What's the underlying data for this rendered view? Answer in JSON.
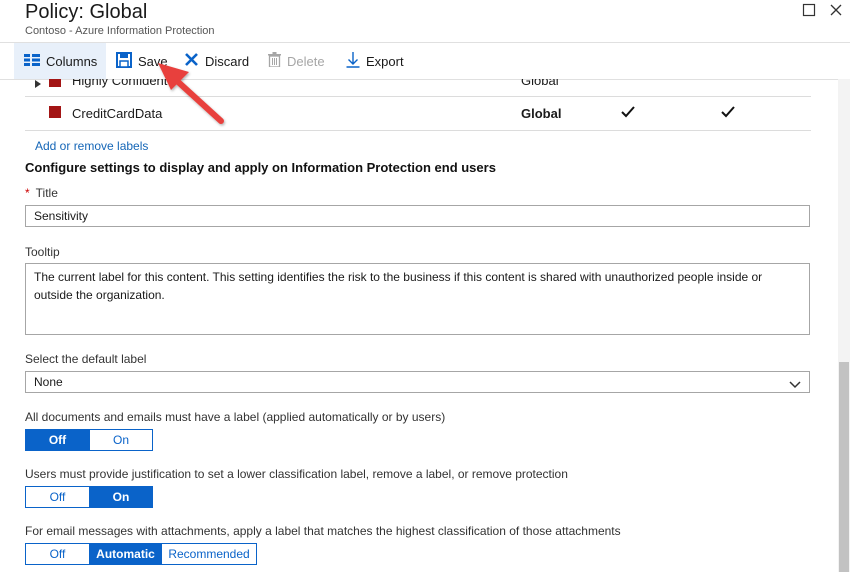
{
  "header": {
    "title": "Policy: Global",
    "subtitle": "Contoso - Azure Information Protection"
  },
  "toolbar": {
    "columns_label": "Columns",
    "save_label": "Save",
    "discard_label": "Discard",
    "delete_label": "Delete",
    "export_label": "Export"
  },
  "labels_table": {
    "rows": [
      {
        "name": "Highly Confident",
        "scope": "Global",
        "color": "#a31515"
      },
      {
        "name": "CreditCardData",
        "scope": "Global",
        "color": "#a31515",
        "check1": true,
        "check2": true
      }
    ],
    "add_remove_link": "Add or remove labels"
  },
  "settings": {
    "section_title": "Configure settings to display and apply on Information Protection end users",
    "title_field": {
      "label": "Title",
      "value": "Sensitivity"
    },
    "tooltip_field": {
      "label": "Tooltip",
      "value_line1": "The current label for this content. This setting identifies the risk to the business if this content is shared with unauthorized people inside or",
      "value_line2": "outside the organization."
    },
    "default_label": {
      "label": "Select the default label",
      "value": "None"
    },
    "mandatory": {
      "label": "All documents and emails must have a label (applied automatically or by users)",
      "options": [
        "Off",
        "On"
      ],
      "selected": "Off"
    },
    "justification": {
      "label": "Users must provide justification to set a lower classification label, remove a label, or remove protection",
      "options": [
        "Off",
        "On"
      ],
      "selected": "On"
    },
    "attachments": {
      "label": "For email messages with attachments, apply a label that matches the highest classification of those attachments",
      "options": [
        "Off",
        "Automatic",
        "Recommended"
      ],
      "selected": "Automatic"
    }
  },
  "colors": {
    "accent": "#0a63c9",
    "link": "#1566b7",
    "label_swatch": "#a31515",
    "annotation_arrow": "#e8413c"
  }
}
